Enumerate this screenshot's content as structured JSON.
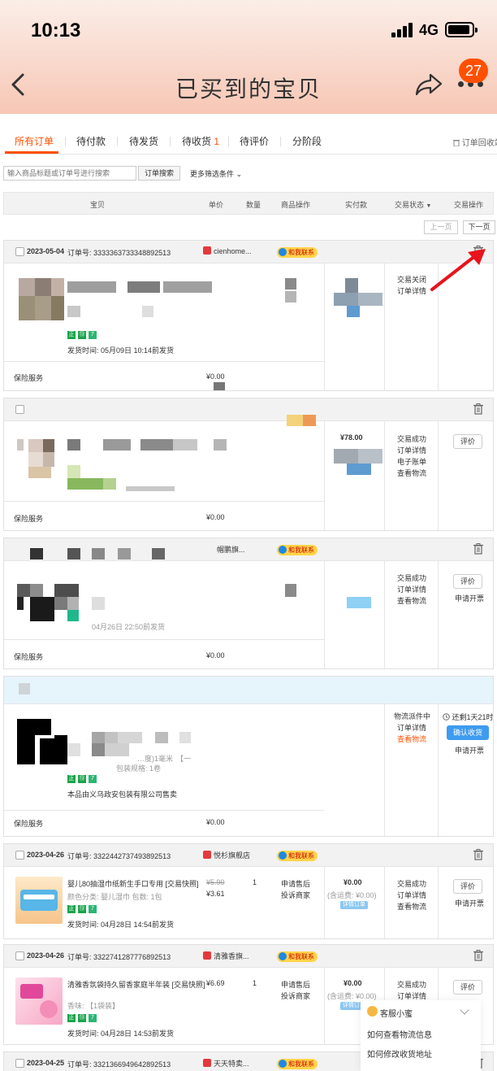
{
  "status_bar": {
    "time": "10:13",
    "network": "4G"
  },
  "nav": {
    "title": "已买到的宝贝",
    "notification_count": "27"
  },
  "tabs": [
    {
      "label": "所有订单"
    },
    {
      "label": "待付款"
    },
    {
      "label": "待发货"
    },
    {
      "label": "待收货",
      "count": "1"
    },
    {
      "label": "待评价"
    },
    {
      "label": "分阶段"
    }
  ],
  "recycle_label": "订单回收站",
  "search": {
    "placeholder": "输入商品标题或订单号进行搜索",
    "button": "订单搜索",
    "more_filters": "更多筛选条件"
  },
  "table_headers": [
    "宝贝",
    "单价",
    "数量",
    "商品操作",
    "实付款",
    "交易状态",
    "交易操作"
  ],
  "pager": {
    "prev": "上一页",
    "next": "下一页"
  },
  "common": {
    "insurance": "保险服务",
    "zero_price": "¥0.00",
    "contact": "和我联系",
    "review": "评价",
    "invoice": "申请开票",
    "order_details": "订单详情",
    "view_logistics": "查看物流"
  },
  "order1": {
    "date": "2023-05-04",
    "order_no": "订单号: 3333363733348892513",
    "shop": "cienhome...",
    "ship_time": "发货时间: 05月09日 10:14前发货",
    "status": "交易关闭",
    "details": "订单详情"
  },
  "order2": {
    "paid": "¥78.00",
    "status": "交易成功",
    "details": "订单详情",
    "extra1": "电子账单",
    "extra2": "查看物流"
  },
  "order3": {
    "shop": "帽鹏旗...",
    "status": "交易成功",
    "details": "订单详情",
    "logistics": "查看物流",
    "partial_ship": "04月26日 22:50前发货"
  },
  "order4": {
    "status": "物流派件中",
    "details": "订单详情",
    "logistics": "查看物流",
    "remaining": "还剩1天21时",
    "confirm": "确认收货",
    "spec_partial": "【一",
    "spec_label": "包装规格: 1卷",
    "seller": "本品由义乌政安包装有限公司售卖",
    "variant_partial": "…度)1毫米"
  },
  "order5": {
    "date": "2023-04-26",
    "order_no": "订单号: 3322442737493892513",
    "shop": "悦杉旗舰店",
    "title": "婴儿80抽湿巾纸新生手口专用 [交易快照]",
    "spec": "颜色分类: 婴儿湿巾  包数: 1包",
    "ship_time": "发货时间: 04月28日 14:54前发货",
    "orig_price": "¥5.90",
    "price": "¥3.61",
    "qty": "1",
    "op1": "申请售后",
    "op2": "投诉商家",
    "paid": "¥0.00",
    "shipping": "(含运费: ¥0.00)",
    "tag": "详情订单",
    "status": "交易成功",
    "details": "订单详情",
    "logistics": "查看物流"
  },
  "order6": {
    "date": "2023-04-26",
    "order_no": "订单号: 3322741287776892513",
    "shop": "清雅香旗...",
    "title": "清雅香氛袋持久留香家庭半年装 [交易快照]",
    "spec": "香味: 【1袋装】",
    "ship_time": "发货时间: 04月28日 14:53前发货",
    "price": "¥6.69",
    "qty": "1",
    "op1": "申请售后",
    "op2": "投诉商家",
    "paid": "¥0.00",
    "shipping": "(含运费: ¥0.00)",
    "tag": "详情订单",
    "status": "交易成功",
    "details": "订单详情"
  },
  "order7": {
    "date": "2023-04-25",
    "order_no": "订单号: 3321366949642892513",
    "shop": "天天特卖..."
  },
  "cs": {
    "title": "客服小蜜",
    "q1": "如何查看物流信息",
    "q2": "如何修改收货地址"
  },
  "colors": {
    "accent": "#ff5000",
    "blue": "#3e9bf0",
    "header_grad_top": "#fbeee8",
    "header_grad_bottom": "#f7c7b5",
    "arrow": "#e8131c"
  }
}
